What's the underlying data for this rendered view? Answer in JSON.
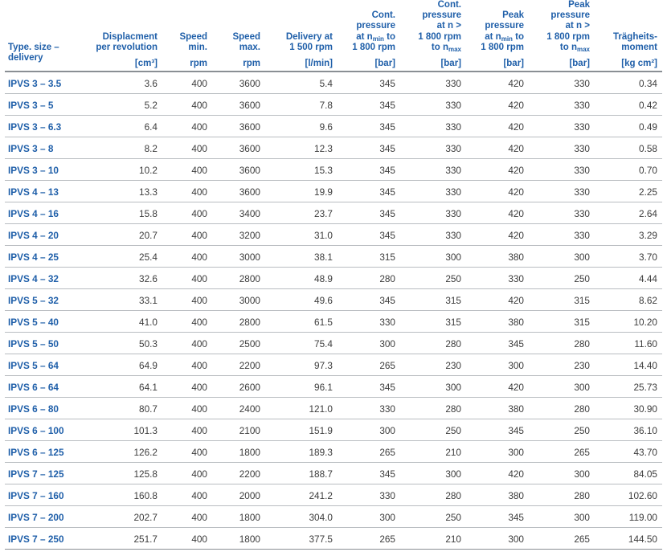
{
  "table": {
    "columns": [
      {
        "key": "type",
        "title_lines": [],
        "label_lines": [
          "Type. size –",
          "delivery"
        ],
        "unit": ""
      },
      {
        "key": "displacement",
        "title_lines": [
          "Displacment",
          "per revolution"
        ],
        "unit": "[cm³]"
      },
      {
        "key": "speed_min",
        "title_lines": [
          "Speed",
          "min."
        ],
        "unit": "rpm"
      },
      {
        "key": "speed_max",
        "title_lines": [
          "Speed",
          "max."
        ],
        "unit": "rpm"
      },
      {
        "key": "delivery_1500",
        "title_lines": [
          "Delivery at",
          "1 500 rpm"
        ],
        "unit": "[l/min]"
      },
      {
        "key": "cont_pressure_nmin",
        "title_lines": [
          "Cont.",
          "pressure",
          "at n_min to",
          "1 800 rpm"
        ],
        "unit": "[bar]"
      },
      {
        "key": "cont_pressure_n1800",
        "title_lines": [
          "Cont.",
          "pressure",
          "at n >",
          "1 800 rpm",
          "to n_max"
        ],
        "unit": "[bar]"
      },
      {
        "key": "peak_pressure_nmin",
        "title_lines": [
          "Peak",
          "pressure",
          "at n_min to",
          "1 800 rpm"
        ],
        "unit": "[bar]"
      },
      {
        "key": "peak_pressure_n1800",
        "title_lines": [
          "Peak",
          "pressure",
          "at n >",
          "1 800 rpm",
          "to n_max"
        ],
        "unit": "[bar]"
      },
      {
        "key": "inertia",
        "title_lines": [
          "Trägheits-",
          "moment"
        ],
        "unit": "[kg cm²]"
      }
    ],
    "rows": [
      {
        "type": "IPVS 3 – 3.5",
        "displacement": "3.6",
        "speed_min": "400",
        "speed_max": "3600",
        "delivery_1500": "5.4",
        "cont_pressure_nmin": "345",
        "cont_pressure_n1800": "330",
        "peak_pressure_nmin": "420",
        "peak_pressure_n1800": "330",
        "inertia": "0.34"
      },
      {
        "type": "IPVS 3 – 5",
        "displacement": "5.2",
        "speed_min": "400",
        "speed_max": "3600",
        "delivery_1500": "7.8",
        "cont_pressure_nmin": "345",
        "cont_pressure_n1800": "330",
        "peak_pressure_nmin": "420",
        "peak_pressure_n1800": "330",
        "inertia": "0.42"
      },
      {
        "type": "IPVS 3 – 6.3",
        "displacement": "6.4",
        "speed_min": "400",
        "speed_max": "3600",
        "delivery_1500": "9.6",
        "cont_pressure_nmin": "345",
        "cont_pressure_n1800": "330",
        "peak_pressure_nmin": "420",
        "peak_pressure_n1800": "330",
        "inertia": "0.49"
      },
      {
        "type": "IPVS 3 – 8",
        "displacement": "8.2",
        "speed_min": "400",
        "speed_max": "3600",
        "delivery_1500": "12.3",
        "cont_pressure_nmin": "345",
        "cont_pressure_n1800": "330",
        "peak_pressure_nmin": "420",
        "peak_pressure_n1800": "330",
        "inertia": "0.58"
      },
      {
        "type": "IPVS 3 – 10",
        "displacement": "10.2",
        "speed_min": "400",
        "speed_max": "3600",
        "delivery_1500": "15.3",
        "cont_pressure_nmin": "345",
        "cont_pressure_n1800": "330",
        "peak_pressure_nmin": "420",
        "peak_pressure_n1800": "330",
        "inertia": "0.70"
      },
      {
        "type": "IPVS 4 – 13",
        "displacement": "13.3",
        "speed_min": "400",
        "speed_max": "3600",
        "delivery_1500": "19.9",
        "cont_pressure_nmin": "345",
        "cont_pressure_n1800": "330",
        "peak_pressure_nmin": "420",
        "peak_pressure_n1800": "330",
        "inertia": "2.25"
      },
      {
        "type": "IPVS 4 – 16",
        "displacement": "15.8",
        "speed_min": "400",
        "speed_max": "3400",
        "delivery_1500": "23.7",
        "cont_pressure_nmin": "345",
        "cont_pressure_n1800": "330",
        "peak_pressure_nmin": "420",
        "peak_pressure_n1800": "330",
        "inertia": "2.64"
      },
      {
        "type": "IPVS 4 – 20",
        "displacement": "20.7",
        "speed_min": "400",
        "speed_max": "3200",
        "delivery_1500": "31.0",
        "cont_pressure_nmin": "345",
        "cont_pressure_n1800": "330",
        "peak_pressure_nmin": "420",
        "peak_pressure_n1800": "330",
        "inertia": "3.29"
      },
      {
        "type": "IPVS 4 – 25",
        "displacement": "25.4",
        "speed_min": "400",
        "speed_max": "3000",
        "delivery_1500": "38.1",
        "cont_pressure_nmin": "315",
        "cont_pressure_n1800": "300",
        "peak_pressure_nmin": "380",
        "peak_pressure_n1800": "300",
        "inertia": "3.70"
      },
      {
        "type": "IPVS 4 – 32",
        "displacement": "32.6",
        "speed_min": "400",
        "speed_max": "2800",
        "delivery_1500": "48.9",
        "cont_pressure_nmin": "280",
        "cont_pressure_n1800": "250",
        "peak_pressure_nmin": "330",
        "peak_pressure_n1800": "250",
        "inertia": "4.44"
      },
      {
        "type": "IPVS 5 – 32",
        "displacement": "33.1",
        "speed_min": "400",
        "speed_max": "3000",
        "delivery_1500": "49.6",
        "cont_pressure_nmin": "345",
        "cont_pressure_n1800": "315",
        "peak_pressure_nmin": "420",
        "peak_pressure_n1800": "315",
        "inertia": "8.62"
      },
      {
        "type": "IPVS 5 – 40",
        "displacement": "41.0",
        "speed_min": "400",
        "speed_max": "2800",
        "delivery_1500": "61.5",
        "cont_pressure_nmin": "330",
        "cont_pressure_n1800": "315",
        "peak_pressure_nmin": "380",
        "peak_pressure_n1800": "315",
        "inertia": "10.20"
      },
      {
        "type": "IPVS 5 – 50",
        "displacement": "50.3",
        "speed_min": "400",
        "speed_max": "2500",
        "delivery_1500": "75.4",
        "cont_pressure_nmin": "300",
        "cont_pressure_n1800": "280",
        "peak_pressure_nmin": "345",
        "peak_pressure_n1800": "280",
        "inertia": "11.60"
      },
      {
        "type": "IPVS 5 – 64",
        "displacement": "64.9",
        "speed_min": "400",
        "speed_max": "2200",
        "delivery_1500": "97.3",
        "cont_pressure_nmin": "265",
        "cont_pressure_n1800": "230",
        "peak_pressure_nmin": "300",
        "peak_pressure_n1800": "230",
        "inertia": "14.40"
      },
      {
        "type": "IPVS 6 – 64",
        "displacement": "64.1",
        "speed_min": "400",
        "speed_max": "2600",
        "delivery_1500": "96.1",
        "cont_pressure_nmin": "345",
        "cont_pressure_n1800": "300",
        "peak_pressure_nmin": "420",
        "peak_pressure_n1800": "300",
        "inertia": "25.73"
      },
      {
        "type": "IPVS 6 – 80",
        "displacement": "80.7",
        "speed_min": "400",
        "speed_max": "2400",
        "delivery_1500": "121.0",
        "cont_pressure_nmin": "330",
        "cont_pressure_n1800": "280",
        "peak_pressure_nmin": "380",
        "peak_pressure_n1800": "280",
        "inertia": "30.90"
      },
      {
        "type": "IPVS 6 – 100",
        "displacement": "101.3",
        "speed_min": "400",
        "speed_max": "2100",
        "delivery_1500": "151.9",
        "cont_pressure_nmin": "300",
        "cont_pressure_n1800": "250",
        "peak_pressure_nmin": "345",
        "peak_pressure_n1800": "250",
        "inertia": "36.10"
      },
      {
        "type": "IPVS 6 – 125",
        "displacement": "126.2",
        "speed_min": "400",
        "speed_max": "1800",
        "delivery_1500": "189.3",
        "cont_pressure_nmin": "265",
        "cont_pressure_n1800": "210",
        "peak_pressure_nmin": "300",
        "peak_pressure_n1800": "265",
        "inertia": "43.70"
      },
      {
        "type": "IPVS 7 – 125",
        "displacement": "125.8",
        "speed_min": "400",
        "speed_max": "2200",
        "delivery_1500": "188.7",
        "cont_pressure_nmin": "345",
        "cont_pressure_n1800": "300",
        "peak_pressure_nmin": "420",
        "peak_pressure_n1800": "300",
        "inertia": "84.05"
      },
      {
        "type": "IPVS 7 – 160",
        "displacement": "160.8",
        "speed_min": "400",
        "speed_max": "2000",
        "delivery_1500": "241.2",
        "cont_pressure_nmin": "330",
        "cont_pressure_n1800": "280",
        "peak_pressure_nmin": "380",
        "peak_pressure_n1800": "280",
        "inertia": "102.60"
      },
      {
        "type": "IPVS 7 – 200",
        "displacement": "202.7",
        "speed_min": "400",
        "speed_max": "1800",
        "delivery_1500": "304.0",
        "cont_pressure_nmin": "300",
        "cont_pressure_n1800": "250",
        "peak_pressure_nmin": "345",
        "peak_pressure_n1800": "300",
        "inertia": "119.00"
      },
      {
        "type": "IPVS 7 – 250",
        "displacement": "251.7",
        "speed_min": "400",
        "speed_max": "1800",
        "delivery_1500": "377.5",
        "cont_pressure_nmin": "265",
        "cont_pressure_n1800": "210",
        "peak_pressure_nmin": "300",
        "peak_pressure_n1800": "265",
        "inertia": "144.50"
      }
    ]
  },
  "colors": {
    "accent_blue": "#1f5fa9",
    "data_text": "#3c3c3c",
    "rule_light": "#b9bdc1",
    "rule_heavy": "#8a8f94",
    "background": "#ffffff"
  }
}
